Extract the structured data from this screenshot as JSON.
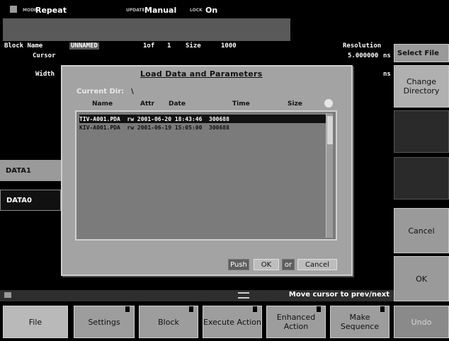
{
  "status": {
    "mode_key": "MODE",
    "mode_value": "Repeat",
    "update_key": "UPDATE",
    "update_value": "Manual",
    "lock_key": "LOCK",
    "lock_value": "On"
  },
  "block": {
    "name_label": "Block Name",
    "name_value": "UNNAMED",
    "of_label": "1of",
    "of_value": "1",
    "size_label": "Size",
    "size_value": "1000",
    "resolution_label": "Resolution",
    "cursor_label": "Cursor",
    "width_label": "Width",
    "unit_ns_1": "ns",
    "unit_ns_2": "ns",
    "num_value": "5.000000"
  },
  "left": {
    "data1": "DATA1",
    "data0": "DATA0"
  },
  "dialog": {
    "title": "Load Data and Parameters",
    "current_dir_label": "Current Dir:",
    "current_dir_value": "\\",
    "columns": [
      "Name",
      "Attr",
      "Date",
      "Time",
      "Size"
    ],
    "files": [
      {
        "text": "TIV-A001.PDA  rw 2001-06-20 18:43:46  300688"
      },
      {
        "text": "KIV-A001.PDA  rw 2001-06-19 15:05:00  300688"
      }
    ],
    "push_label": "Push",
    "ok_label": "OK",
    "or_label": "or",
    "cancel_label": "Cancel"
  },
  "side": {
    "title": "Select File",
    "change_dir": "Change Directory",
    "cancel": "Cancel",
    "ok": "OK"
  },
  "message": "Move cursor to prev/next",
  "bottom": {
    "file": "File",
    "settings": "Settings",
    "block": "Block",
    "execute": "Execute Action",
    "enhanced": "Enhanced Action",
    "make_seq": "Make Sequence",
    "undo": "Undo"
  }
}
